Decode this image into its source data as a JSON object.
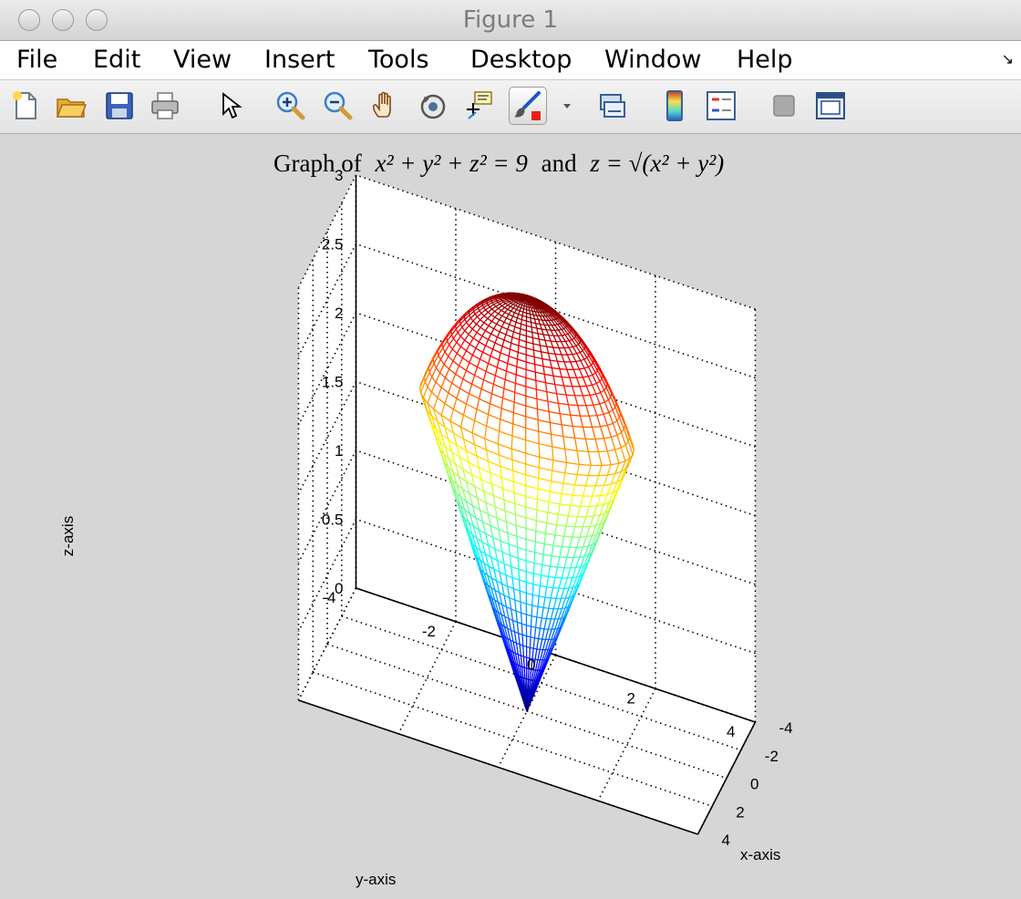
{
  "window": {
    "title": "Figure 1"
  },
  "menu": {
    "items": [
      "File",
      "Edit",
      "View",
      "Insert",
      "Tools",
      "Desktop",
      "Window",
      "Help"
    ]
  },
  "toolbar": {
    "icons": [
      "new-figure-icon",
      "open-file-icon",
      "save-icon",
      "print-icon",
      "edit-plot-icon",
      "zoom-in-icon",
      "zoom-out-icon",
      "pan-icon",
      "rotate-3d-icon",
      "data-cursor-icon",
      "brush-icon",
      "brush-dropdown-icon",
      "link-plot-icon",
      "insert-colorbar-icon",
      "insert-legend-icon",
      "hide-plot-tools-icon",
      "show-plot-tools-icon"
    ]
  },
  "colors": {
    "surface_colormap": "jet",
    "background": "#d6d6d6",
    "axes": "#ffffff"
  },
  "chart_data": {
    "type": "surface",
    "title_plain": "Graph of",
    "title_mid": "and",
    "title_eq1": "x² + y² + z² = 9",
    "title_eq2": "z = √(x² + y²)",
    "xlabel": "x-axis",
    "ylabel": "y-axis",
    "zlabel": "z-axis",
    "xlim": [
      -4,
      4
    ],
    "ylim": [
      -4,
      4
    ],
    "zlim": [
      0,
      3
    ],
    "xticks": [
      -4,
      -2,
      0,
      2,
      4
    ],
    "yticks": [
      -4,
      -2,
      0,
      2,
      4
    ],
    "zticks": [
      0,
      0.5,
      1,
      1.5,
      2,
      2.5,
      3
    ],
    "ztick_labels": [
      "0",
      "0.5",
      "1",
      "1.5",
      "2",
      "2.5",
      "3"
    ],
    "grid": true,
    "surfaces": [
      {
        "name": "cone",
        "equation": "z = sqrt(x^2 + y^2)",
        "z_range": [
          0,
          2.12
        ]
      },
      {
        "name": "sphere cap",
        "equation": "x^2 + y^2 + z^2 = 9",
        "z_range": [
          2.12,
          3
        ]
      }
    ]
  }
}
